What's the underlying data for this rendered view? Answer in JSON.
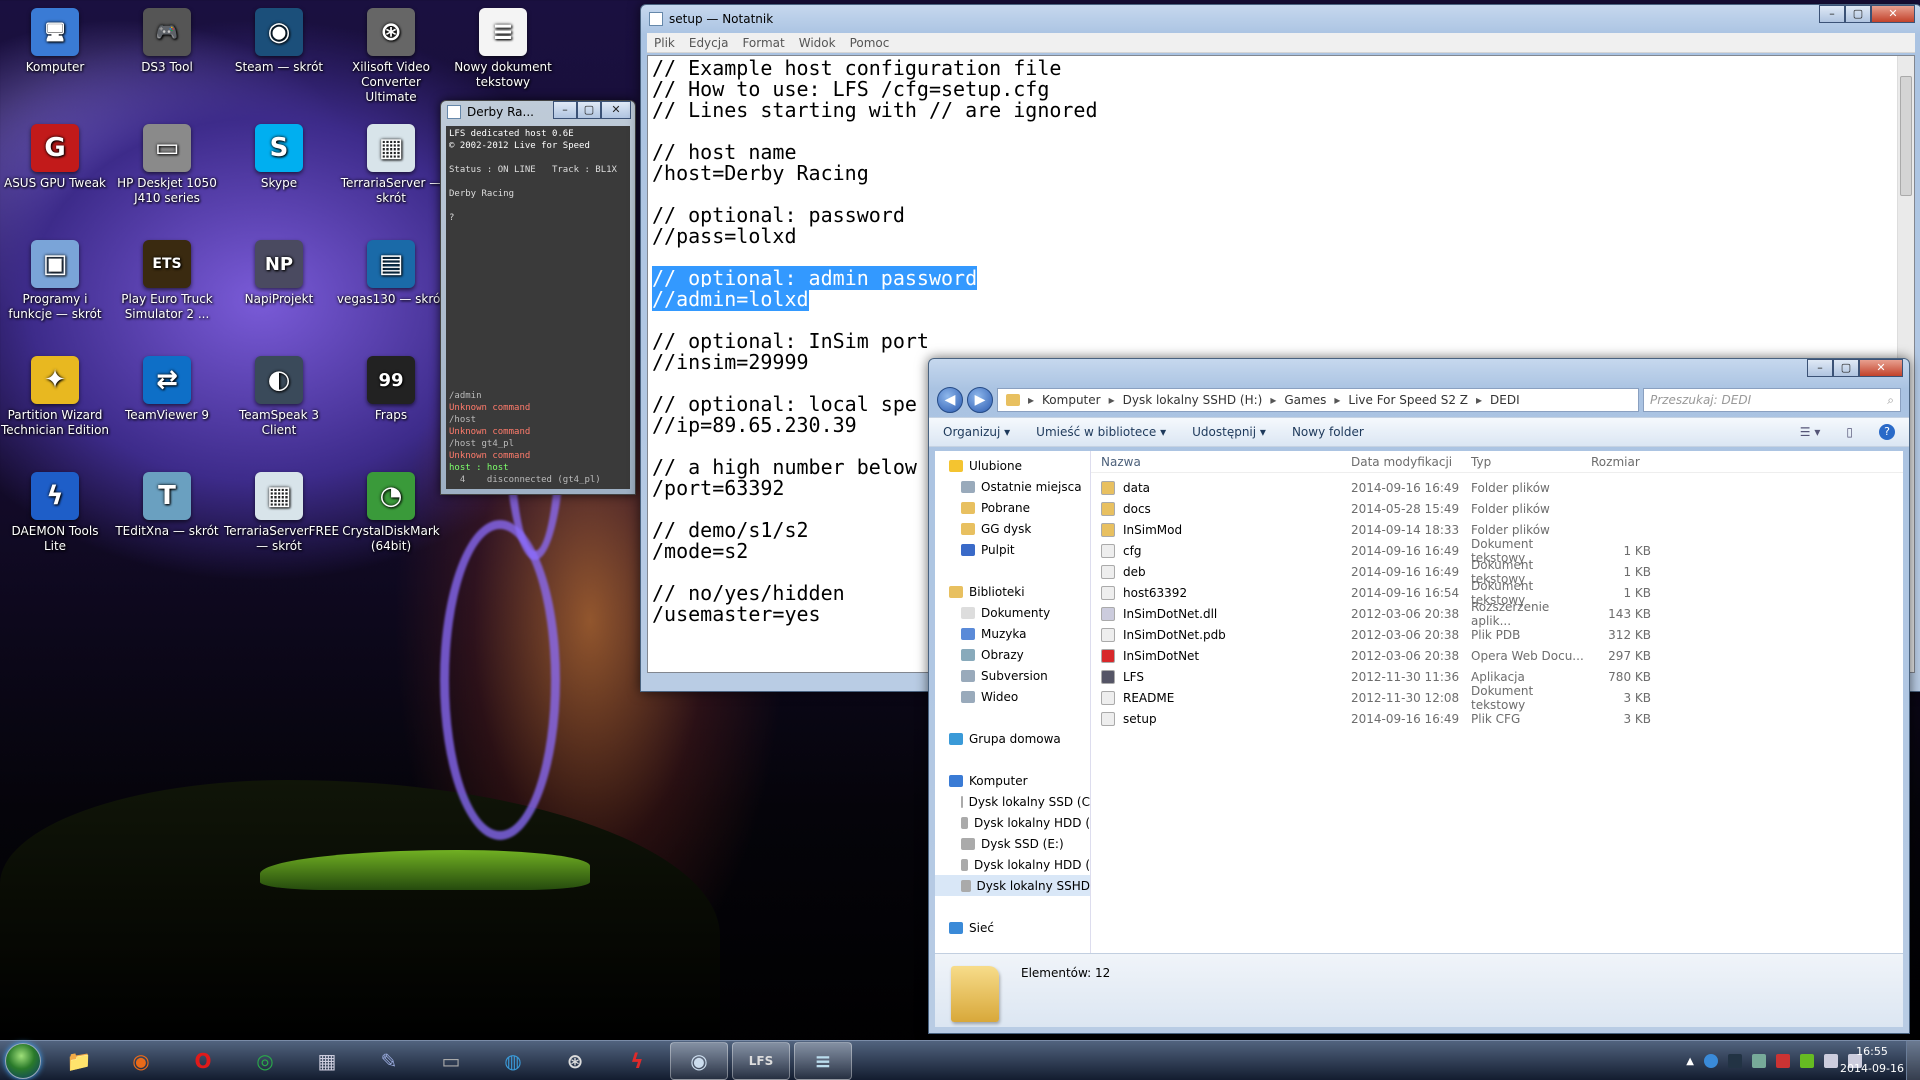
{
  "desktop": {
    "icons": [
      {
        "label": "Komputer",
        "icon": "computer-icon",
        "glyph": "🖥",
        "color": "#3a7bd5"
      },
      {
        "label": "DS3 Tool",
        "icon": "gamepad-icon",
        "glyph": "🎮",
        "color": "#555"
      },
      {
        "label": "Steam — skrót",
        "icon": "steam-icon",
        "glyph": "◉",
        "color": "#1b4f7a"
      },
      {
        "label": "Xilisoft Video Converter Ultimate",
        "icon": "film-reel-icon",
        "glyph": "⊛",
        "color": "#666"
      },
      {
        "label": "Nowy dokument tekstowy",
        "icon": "text-document-icon",
        "glyph": "≡",
        "color": "#f4f4f4"
      },
      {
        "label": "ASUS GPU Tweak",
        "icon": "gpu-tweak-icon",
        "glyph": "G",
        "color": "#c21a1a"
      },
      {
        "label": "HP Deskjet 1050 J410 series",
        "icon": "printer-icon",
        "glyph": "▭",
        "color": "#8a8a8a"
      },
      {
        "label": "Skype",
        "icon": "skype-icon",
        "glyph": "S",
        "color": "#00aff0"
      },
      {
        "label": "TerrariaServer — skrót",
        "icon": "terraria-server-icon",
        "glyph": "▦",
        "color": "#d8e4ea"
      },
      {
        "label": "Programy i funkcje — skrót",
        "icon": "programs-features-icon",
        "glyph": "▣",
        "color": "#7aa4d8"
      },
      {
        "label": "Play Euro Truck Simulator 2 ...",
        "icon": "euro-truck-icon",
        "glyph": "ETS",
        "color": "#3a2a10"
      },
      {
        "label": "NapiProjekt",
        "icon": "napiprojekt-icon",
        "glyph": "NP",
        "color": "#4a4a60"
      },
      {
        "label": "vegas130 — skrót",
        "icon": "vegas-icon",
        "glyph": "▤",
        "color": "#1a6aa8"
      },
      {
        "label": "Partition Wizard Technician Edition",
        "icon": "partition-wizard-icon",
        "glyph": "✦",
        "color": "#e8b820"
      },
      {
        "label": "TeamViewer 9",
        "icon": "teamviewer-icon",
        "glyph": "⇄",
        "color": "#0e6fc7"
      },
      {
        "label": "TeamSpeak 3 Client",
        "icon": "teamspeak-icon",
        "glyph": "◐",
        "color": "#3a4a5a"
      },
      {
        "label": "Fraps",
        "icon": "fraps-icon",
        "glyph": "99",
        "color": "#222"
      },
      {
        "label": "DAEMON Tools Lite",
        "icon": "daemon-tools-icon",
        "glyph": "ϟ",
        "color": "#1e5ec8"
      },
      {
        "label": "TEditXna — skrót",
        "icon": "teditxna-icon",
        "glyph": "T",
        "color": "#6aa0c0"
      },
      {
        "label": "TerrariaServerFREE — skrót",
        "icon": "terraria-server-free-icon",
        "glyph": "▦",
        "color": "#d8e4ea"
      },
      {
        "label": "CrystalDiskMark (64bit)",
        "icon": "crystaldiskmark-icon",
        "glyph": "◔",
        "color": "#3a9a3a"
      }
    ]
  },
  "console": {
    "title": "Derby Ra...",
    "lines": [
      {
        "text": "LFS dedicated host 0.6E",
        "color": "#ffffff"
      },
      {
        "text": "© 2002-2012 Live for Speed",
        "color": "#ffffff"
      },
      {
        "text": "",
        "color": "#eee"
      },
      {
        "text": "Status : ON LINE   Track : BL1X",
        "color": "#dddddd"
      },
      {
        "text": "",
        "color": "#eee"
      },
      {
        "text": "Derby Racing",
        "color": "#dddddd"
      },
      {
        "text": "",
        "color": "#eee"
      },
      {
        "text": "?",
        "color": "#dddddd"
      }
    ],
    "log": [
      {
        "text": "/admin",
        "color": "#bbbbbb"
      },
      {
        "text": "Unknown command",
        "color": "#ff7b6b"
      },
      {
        "text": "/host",
        "color": "#bbbbbb"
      },
      {
        "text": "Unknown command",
        "color": "#ff7b6b"
      },
      {
        "text": "/host gt4_pl",
        "color": "#bbbbbb"
      },
      {
        "text": "Unknown command",
        "color": "#ff7b6b"
      },
      {
        "text": "host : host",
        "color": "#7dff6b"
      },
      {
        "text": "  4    disconnected (gt4_pl)",
        "color": "#bbbbbb"
      }
    ]
  },
  "notepad": {
    "title": "setup — Notatnik",
    "menu": [
      "Plik",
      "Edycja",
      "Format",
      "Widok",
      "Pomoc"
    ],
    "lines": [
      {
        "text": "// Example host configuration file",
        "sel": false
      },
      {
        "text": "// How to use: LFS /cfg=setup.cfg",
        "sel": false
      },
      {
        "text": "// Lines starting with // are ignored",
        "sel": false
      },
      {
        "text": "",
        "sel": false
      },
      {
        "text": "// host name",
        "sel": false
      },
      {
        "text": "/host=Derby Racing",
        "sel": false
      },
      {
        "text": "",
        "sel": false
      },
      {
        "text": "// optional: password",
        "sel": false
      },
      {
        "text": "//pass=lolxd",
        "sel": false
      },
      {
        "text": "",
        "sel": false
      },
      {
        "text": "// optional: admin password",
        "sel": true
      },
      {
        "text": "//admin=lolxd",
        "sel": true
      },
      {
        "text": "",
        "sel": false
      },
      {
        "text": "// optional: InSim port",
        "sel": false
      },
      {
        "text": "//insim=29999",
        "sel": false
      },
      {
        "text": "",
        "sel": false
      },
      {
        "text": "// optional: local spe",
        "sel": false
      },
      {
        "text": "//ip=89.65.230.39",
        "sel": false
      },
      {
        "text": "",
        "sel": false
      },
      {
        "text": "// a high number below",
        "sel": false
      },
      {
        "text": "/port=63392",
        "sel": false
      },
      {
        "text": "",
        "sel": false
      },
      {
        "text": "// demo/s1/s2",
        "sel": false
      },
      {
        "text": "/mode=s2",
        "sel": false
      },
      {
        "text": "",
        "sel": false
      },
      {
        "text": "// no/yes/hidden",
        "sel": false
      },
      {
        "text": "/usemaster=yes",
        "sel": false
      }
    ]
  },
  "explorer": {
    "breadcrumb": [
      "Komputer",
      "Dysk lokalny SSHD (H:)",
      "Games",
      "Live For Speed S2 Z",
      "DEDI"
    ],
    "search_placeholder": "Przeszukaj: DEDI",
    "toolbar": [
      "Organizuj ▾",
      "Umieść w bibliotece ▾",
      "Udostępnij ▾",
      "Nowy folder"
    ],
    "columns": {
      "name": "Nazwa",
      "date": "Data modyfikacji",
      "type": "Typ",
      "size": "Rozmiar"
    },
    "nav": [
      {
        "label": "Ulubione",
        "indent": 0,
        "color": "#f4c430",
        "selected": false
      },
      {
        "label": "Ostatnie miejsca",
        "indent": 1,
        "color": "#9ab",
        "selected": false
      },
      {
        "label": "Pobrane",
        "indent": 1,
        "color": "#e8c060",
        "selected": false
      },
      {
        "label": "GG dysk",
        "indent": 1,
        "color": "#e8c060",
        "selected": false
      },
      {
        "label": "Pulpit",
        "indent": 1,
        "color": "#3a6ac8",
        "selected": false
      },
      {
        "label": "",
        "indent": 0,
        "color": "transparent",
        "selected": false
      },
      {
        "label": "Biblioteki",
        "indent": 0,
        "color": "#e8c060",
        "selected": false
      },
      {
        "label": "Dokumenty",
        "indent": 1,
        "color": "#ddd",
        "selected": false
      },
      {
        "label": "Muzyka",
        "indent": 1,
        "color": "#5a8ad8",
        "selected": false
      },
      {
        "label": "Obrazy",
        "indent": 1,
        "color": "#8ab",
        "selected": false
      },
      {
        "label": "Subversion",
        "indent": 1,
        "color": "#9ab",
        "selected": false
      },
      {
        "label": "Wideo",
        "indent": 1,
        "color": "#9ab",
        "selected": false
      },
      {
        "label": "",
        "indent": 0,
        "color": "transparent",
        "selected": false
      },
      {
        "label": "Grupa domowa",
        "indent": 0,
        "color": "#3a9ad8",
        "selected": false
      },
      {
        "label": "",
        "indent": 0,
        "color": "transparent",
        "selected": false
      },
      {
        "label": "Komputer",
        "indent": 0,
        "color": "#3a7bd5",
        "selected": false
      },
      {
        "label": "Dysk lokalny SSD (C",
        "indent": 1,
        "color": "#aaa",
        "selected": false
      },
      {
        "label": "Dysk lokalny HDD (",
        "indent": 1,
        "color": "#aaa",
        "selected": false
      },
      {
        "label": "Dysk SSD (E:)",
        "indent": 1,
        "color": "#aaa",
        "selected": false
      },
      {
        "label": "Dysk lokalny HDD (",
        "indent": 1,
        "color": "#aaa",
        "selected": false
      },
      {
        "label": "Dysk lokalny SSHD",
        "indent": 1,
        "color": "#aaa",
        "selected": true
      },
      {
        "label": "",
        "indent": 0,
        "color": "transparent",
        "selected": false
      },
      {
        "label": "Sieć",
        "indent": 0,
        "color": "#3a8ad8",
        "selected": false
      }
    ],
    "files": [
      {
        "name": "data",
        "date": "2014-09-16 16:49",
        "type": "Folder plików",
        "size": "",
        "color": "#e8c060"
      },
      {
        "name": "docs",
        "date": "2014-05-28 15:49",
        "type": "Folder plików",
        "size": "",
        "color": "#e8c060"
      },
      {
        "name": "InSimMod",
        "date": "2014-09-14 18:33",
        "type": "Folder plików",
        "size": "",
        "color": "#e8c060"
      },
      {
        "name": "cfg",
        "date": "2014-09-16 16:49",
        "type": "Dokument tekstowy",
        "size": "1 KB",
        "color": "#eee"
      },
      {
        "name": "deb",
        "date": "2014-09-16 16:49",
        "type": "Dokument tekstowy",
        "size": "1 KB",
        "color": "#eee"
      },
      {
        "name": "host63392",
        "date": "2014-09-16 16:54",
        "type": "Dokument tekstowy",
        "size": "1 KB",
        "color": "#eee"
      },
      {
        "name": "InSimDotNet.dll",
        "date": "2012-03-06 20:38",
        "type": "Rozszerzenie aplik...",
        "size": "143 KB",
        "color": "#ccd"
      },
      {
        "name": "InSimDotNet.pdb",
        "date": "2012-03-06 20:38",
        "type": "Plik PDB",
        "size": "312 KB",
        "color": "#eee"
      },
      {
        "name": "InSimDotNet",
        "date": "2012-03-06 20:38",
        "type": "Opera Web Docu...",
        "size": "297 KB",
        "color": "#d8282a"
      },
      {
        "name": "LFS",
        "date": "2012-11-30 11:36",
        "type": "Aplikacja",
        "size": "780 KB",
        "color": "#556"
      },
      {
        "name": "README",
        "date": "2012-11-30 12:08",
        "type": "Dokument tekstowy",
        "size": "3 KB",
        "color": "#eee"
      },
      {
        "name": "setup",
        "date": "2014-09-16 16:49",
        "type": "Plik CFG",
        "size": "3 KB",
        "color": "#eee"
      }
    ],
    "status": "Elementów: 12"
  },
  "taskbar": {
    "apps": [
      {
        "name": "explorer-taskbar-icon",
        "glyph": "📁",
        "color": "#e8c060",
        "active": false
      },
      {
        "name": "firefox-taskbar-icon",
        "glyph": "◉",
        "color": "#e86a1a",
        "active": false
      },
      {
        "name": "opera-taskbar-icon",
        "glyph": "O",
        "color": "#e01a1a",
        "active": false
      },
      {
        "name": "chrome-taskbar-icon",
        "glyph": "◎",
        "color": "#2aa84a",
        "active": false
      },
      {
        "name": "calculator-taskbar-icon",
        "glyph": "▦",
        "color": "#ccd",
        "active": false
      },
      {
        "name": "paint-taskbar-icon",
        "glyph": "✎",
        "color": "#9ad",
        "active": false
      },
      {
        "name": "printer-taskbar-icon",
        "glyph": "▭",
        "color": "#aaa",
        "active": false
      },
      {
        "name": "globe-taskbar-icon",
        "glyph": "◍",
        "color": "#3a9ad8",
        "active": false
      },
      {
        "name": "film-taskbar-icon",
        "glyph": "⊛",
        "color": "#ddd",
        "active": false
      },
      {
        "name": "daemon-taskbar-icon",
        "glyph": "ϟ",
        "color": "#e02a2a",
        "active": false
      },
      {
        "name": "steam-taskbar-icon",
        "glyph": "◉",
        "color": "#cde",
        "active": true
      },
      {
        "name": "lfs-taskbar-icon",
        "glyph": "LFS",
        "color": "#ddd",
        "active": true
      },
      {
        "name": "notepad-taskbar-icon",
        "glyph": "≡",
        "color": "#bde",
        "active": true
      }
    ],
    "time": "16:55",
    "date": "2014-09-16"
  }
}
